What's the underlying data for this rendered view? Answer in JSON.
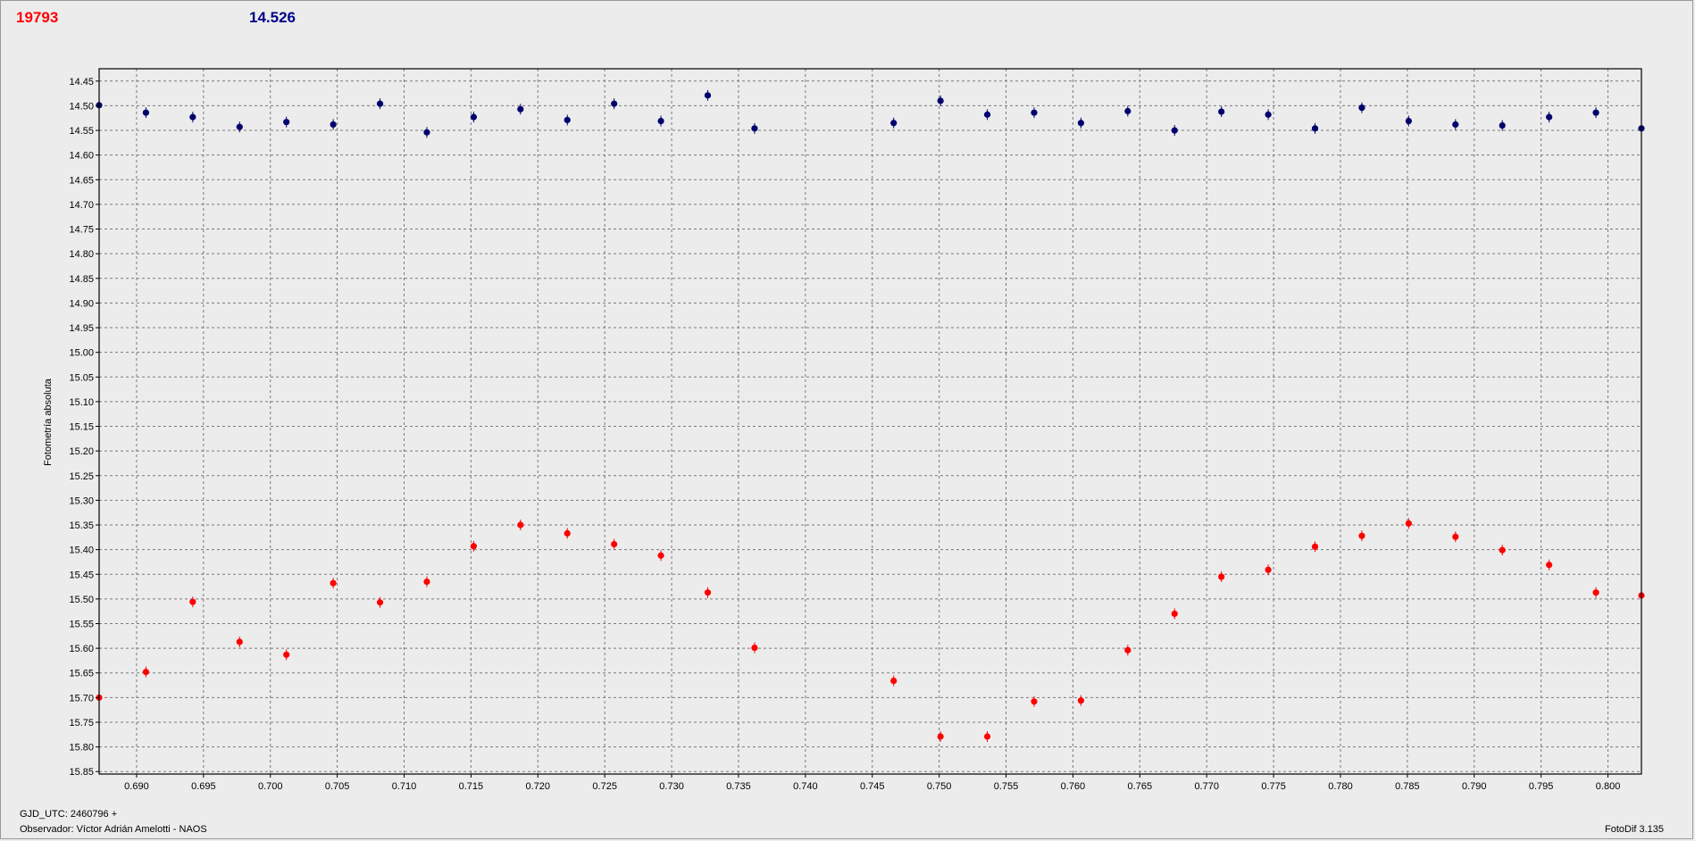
{
  "header": {
    "left_value": "19793",
    "right_value": "14.526"
  },
  "footer": {
    "gjd_label": "GJD_UTC: 2460796 +",
    "observer_label": "Observador: Víctor Adrián Amelotti - NAOS",
    "version_label": "FotoDif 3.135"
  },
  "chart_data": {
    "type": "scatter",
    "title": "",
    "xlabel": "",
    "ylabel": "Fotometría absoluta",
    "xlim": [
      0.6872,
      0.8025
    ],
    "ylim": [
      14.425,
      15.855
    ],
    "y_inverted": true,
    "grid": true,
    "x_ticks": [
      "0.690",
      "0.695",
      "0.700",
      "0.705",
      "0.710",
      "0.715",
      "0.720",
      "0.725",
      "0.730",
      "0.735",
      "0.740",
      "0.745",
      "0.750",
      "0.755",
      "0.760",
      "0.765",
      "0.770",
      "0.775",
      "0.780",
      "0.785",
      "0.790",
      "0.795",
      "0.800"
    ],
    "y_ticks": [
      "14.45",
      "14.50",
      "14.55",
      "14.60",
      "14.65",
      "14.70",
      "14.75",
      "14.80",
      "14.85",
      "14.90",
      "14.95",
      "15.00",
      "15.05",
      "15.10",
      "15.15",
      "15.20",
      "15.25",
      "15.30",
      "15.35",
      "15.40",
      "15.45",
      "15.50",
      "15.55",
      "15.60",
      "15.65",
      "15.70",
      "15.75",
      "15.80",
      "15.85"
    ],
    "series": [
      {
        "color": "#00006e",
        "x": [
          0.6872,
          0.6907,
          0.6942,
          0.6977,
          0.7012,
          0.7047,
          0.7082,
          0.7117,
          0.7152,
          0.7187,
          0.7222,
          0.7257,
          0.7292,
          0.7327,
          0.7362,
          0.7466,
          0.7501,
          0.7536,
          0.7571,
          0.7606,
          0.7641,
          0.7676,
          0.7711,
          0.7746,
          0.7781,
          0.7816,
          0.7851,
          0.7886,
          0.7921,
          0.7956,
          0.7991,
          0.8025
        ],
        "y": [
          14.499,
          14.514,
          14.523,
          14.543,
          14.533,
          14.538,
          14.496,
          14.554,
          14.523,
          14.507,
          14.529,
          14.496,
          14.531,
          14.479,
          14.546,
          14.535,
          14.49,
          14.518,
          14.514,
          14.535,
          14.511,
          14.55,
          14.512,
          14.518,
          14.546,
          14.504,
          14.531,
          14.538,
          14.54,
          14.523,
          14.514,
          14.546
        ]
      },
      {
        "color": "#ff0000",
        "x": [
          0.6872,
          0.6907,
          0.6942,
          0.6977,
          0.7012,
          0.7047,
          0.7082,
          0.7117,
          0.7152,
          0.7187,
          0.7222,
          0.7257,
          0.7292,
          0.7327,
          0.7362,
          0.7466,
          0.7501,
          0.7536,
          0.7571,
          0.7606,
          0.7641,
          0.7676,
          0.7711,
          0.7746,
          0.7781,
          0.7816,
          0.7851,
          0.7886,
          0.7921,
          0.7956,
          0.7991,
          0.8025
        ],
        "y": [
          15.7,
          15.648,
          15.506,
          15.587,
          15.613,
          15.468,
          15.507,
          15.465,
          15.393,
          15.35,
          15.367,
          15.389,
          15.412,
          15.487,
          15.599,
          15.666,
          15.779,
          15.779,
          15.708,
          15.706,
          15.604,
          15.53,
          15.455,
          15.441,
          15.394,
          15.372,
          15.347,
          15.374,
          15.401,
          15.431,
          15.487,
          15.493
        ]
      }
    ]
  }
}
